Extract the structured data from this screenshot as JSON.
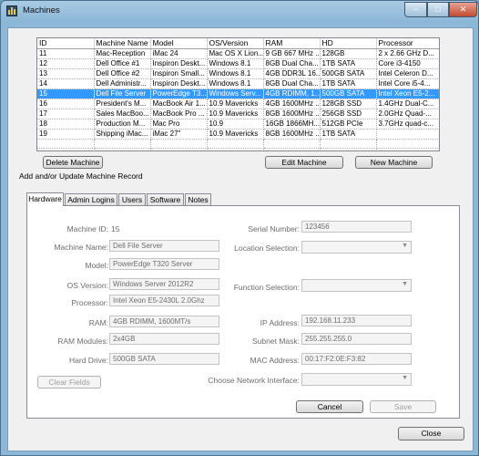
{
  "window": {
    "title": "Machines",
    "minimize_glyph": "–",
    "maximize_glyph": "□",
    "close_glyph": "✕"
  },
  "grid": {
    "columns": [
      "ID",
      "Machine Name",
      "Model",
      "OS/Version",
      "RAM",
      "HD",
      "Processor"
    ],
    "rows": [
      [
        "11",
        "Mac-Reception",
        "iMac 24",
        "Mac OS X Lion...",
        "9 GB 667 MHz ...",
        "128GB",
        "2 x 2.66 GHz D..."
      ],
      [
        "12",
        "Dell Office #1",
        "Inspiron Deskt...",
        "Windows 8.1",
        "8GB Dual Cha...",
        "1TB SATA",
        "Core i3-4150"
      ],
      [
        "13",
        "Dell Office #2",
        "Inspiron Small...",
        "Windows 8.1",
        "4GB DDR3L 16...",
        "500GB SATA",
        "Intel Celeron D..."
      ],
      [
        "14",
        "Dell Administr...",
        "Inspiron Deskt...",
        "Windows 8.1",
        "8GB Dual Cha...",
        "1TB SATA",
        "Intel Core i5-4..."
      ],
      [
        "15",
        "Dell File Server",
        "PowerEdge T3...",
        "Windows Serv...",
        "4GB RDIMM, 1...",
        "500GB SATA",
        "Intel Xeon E5-2..."
      ],
      [
        "16",
        "President's M...",
        "MacBook Air 1...",
        "10.9 Mavericks",
        "4GB 1600MHz ...",
        "128GB SSD",
        "1.4GHz Dual-C..."
      ],
      [
        "17",
        "Sales MacBoo...",
        "MacBook Pro ...",
        "10.9 Mavericks",
        "8GB 1600MHz ...",
        "256GB SSD",
        "2.0GHz Quad-..."
      ],
      [
        "18",
        "Production M...",
        "Mac Pro",
        "10.9",
        "16GB 1866MH...",
        "512GB PCIe",
        "3.7GHz quad-c..."
      ],
      [
        "19",
        "Shipping iMac...",
        "iMac 27\"",
        "10.9 Mavericks",
        "8GB 1600MHz ...",
        "1TB SATA",
        ""
      ],
      [
        "",
        "",
        "",
        "",
        "",
        "",
        ""
      ],
      [
        "",
        "",
        "",
        "",
        "",
        "",
        ""
      ]
    ],
    "selected_index": 4
  },
  "buttons": {
    "delete": "Delete Machine",
    "edit": "Edit Machine",
    "new": "New Machine",
    "clear": "Clear Fields",
    "cancel": "Cancel",
    "save": "Save",
    "close": "Close"
  },
  "section_title": "Add and/or Update Machine Record",
  "tabs": [
    "Hardware",
    "Admin Logins",
    "Users",
    "Software",
    "Notes"
  ],
  "form": {
    "machine_id_label": "Machine ID:",
    "machine_id": "15",
    "machine_name_label": "Machine Name:",
    "machine_name": "Dell File Server",
    "model_label": "Model:",
    "model": "PowerEdge T320 Server",
    "os_label": "OS Version:",
    "os": "Windows Server 2012R2",
    "processor_label": "Processor:",
    "processor": "Intel Xeon E5-2430L 2.0Ghz",
    "ram_label": "RAM:",
    "ram": "4GB RDIMM, 1600MT/s",
    "ram_modules_label": "RAM Modules:",
    "ram_modules": "2x4GB",
    "hard_drive_label": "Hard Drive:",
    "hard_drive": "500GB SATA",
    "serial_label": "Serial Number:",
    "serial": "123456",
    "location_label": "Location Selection:",
    "location": "",
    "function_label": "Function Selection:",
    "function": "",
    "ip_label": "IP Address:",
    "ip": "192.168.11.233",
    "subnet_label": "Subnet Mask:",
    "subnet": "255.255.255.0",
    "mac_label": "MAC Address:",
    "mac": "00:17:F2:0E:F3:82",
    "network_label": "Choose Network Interface:",
    "network": ""
  },
  "colors": {
    "selection": "#3399ff",
    "titlebar": "#8db7d8"
  }
}
